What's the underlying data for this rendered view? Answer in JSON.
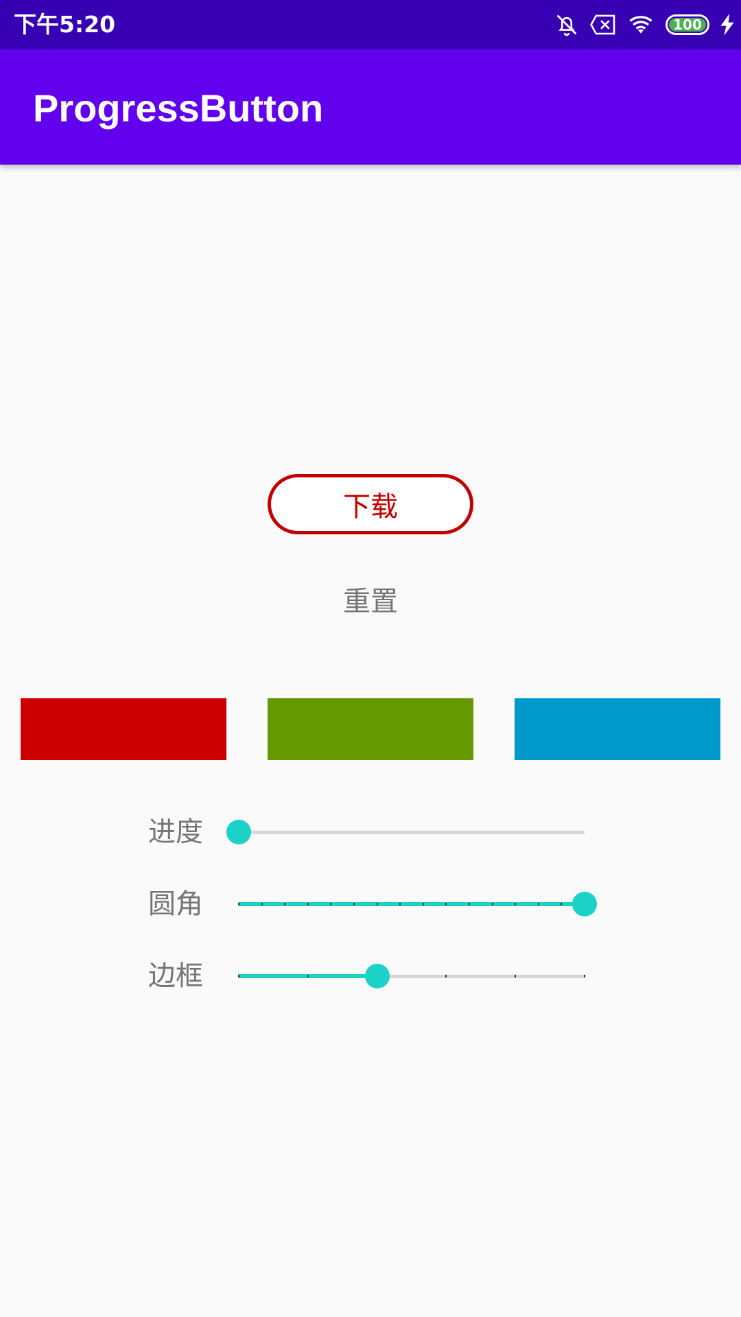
{
  "status_bar": {
    "time": "下午5:20",
    "battery_level": "100",
    "icons": [
      "notifications-off-icon",
      "sim-error-icon",
      "wifi-icon",
      "battery-icon",
      "charging-bolt-icon"
    ],
    "background_color": "#3700b3"
  },
  "app_bar": {
    "title": "ProgressButton",
    "background_color": "#6200ee"
  },
  "main": {
    "download_button": {
      "label": "下载",
      "color": "#c00000"
    },
    "reset_button": {
      "label": "重置"
    },
    "color_swatches": [
      {
        "name": "red",
        "color": "#cc0000"
      },
      {
        "name": "green",
        "color": "#669900"
      },
      {
        "name": "blue",
        "color": "#0099cc"
      }
    ],
    "sliders": [
      {
        "label": "进度",
        "value_fraction": 0.0,
        "discrete_steps": 0
      },
      {
        "label": "圆角",
        "value_fraction": 1.0,
        "discrete_steps": 15
      },
      {
        "label": "边框",
        "value_fraction": 0.4,
        "discrete_steps": 5
      }
    ],
    "accent_color": "#1cd1c5"
  }
}
